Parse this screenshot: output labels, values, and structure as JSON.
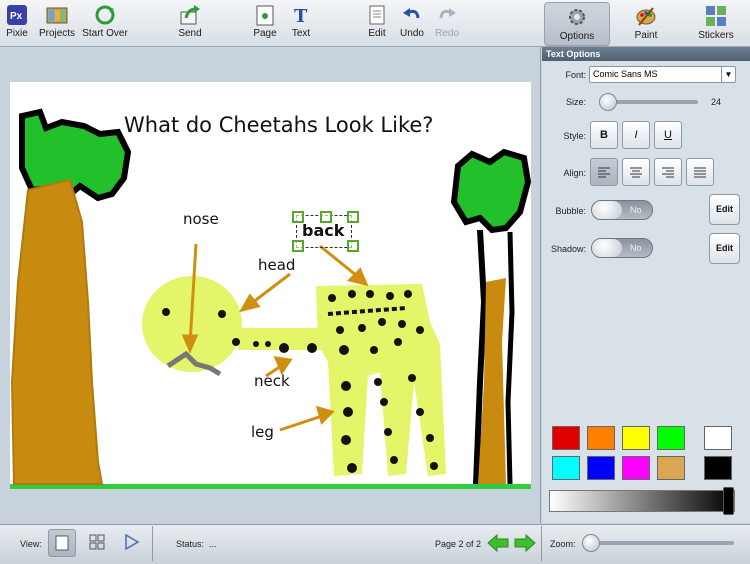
{
  "toolbar": {
    "pixie": "Pixie",
    "projects": "Projects",
    "start_over": "Start Over",
    "send": "Send",
    "page": "Page",
    "text": "Text",
    "edit": "Edit",
    "undo": "Undo",
    "redo": "Redo"
  },
  "right_tabs": {
    "options": "Options",
    "paint": "Paint",
    "stickers": "Stickers"
  },
  "canvas": {
    "title": "What do Cheetahs Look Like?",
    "labels": {
      "nose": "nose",
      "head": "head",
      "back": "back",
      "neck": "neck",
      "leg": "leg"
    }
  },
  "text_options": {
    "header": "Text Options",
    "font_label": "Font:",
    "font_value": "Comic Sans MS",
    "size_label": "Size:",
    "size_value": "24",
    "style_label": "Style:",
    "bold": "B",
    "italic": "I",
    "underline": "U",
    "align_label": "Align:",
    "bubble_label": "Bubble:",
    "bubble_state": "No",
    "shadow_label": "Shadow:",
    "shadow_state": "No",
    "edit_label": "Edit"
  },
  "palette": [
    "#e00000",
    "#ff7f00",
    "#ffff00",
    "#00ff00",
    "#ffffff",
    "#00ffff",
    "#0000ff",
    "#ff00ff",
    "#d9a652",
    "#000000"
  ],
  "bottom": {
    "view_label": "View:",
    "status_label": "Status:",
    "status_value": "...",
    "page_indicator": "Page 2 of 2",
    "zoom_label": "Zoom:"
  }
}
